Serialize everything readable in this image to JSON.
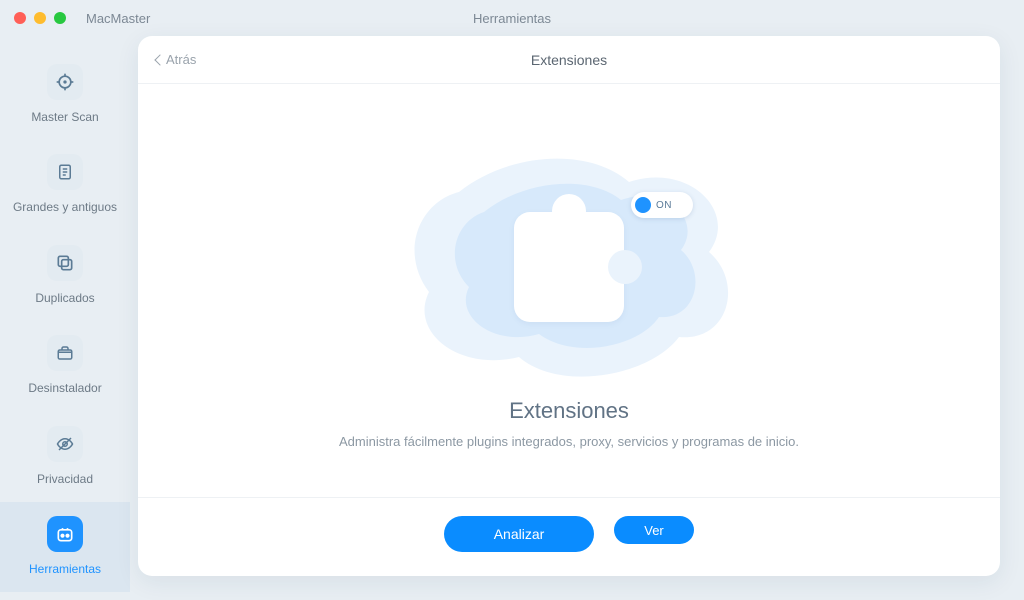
{
  "window": {
    "app_name": "MacMaster",
    "title": "Herramientas"
  },
  "sidebar": {
    "items": [
      {
        "label": "Master Scan",
        "icon": "crosshair-icon"
      },
      {
        "label": "Grandes y antiguos",
        "icon": "document-icon"
      },
      {
        "label": "Duplicados",
        "icon": "copy-icon"
      },
      {
        "label": "Desinstalador",
        "icon": "box-icon"
      },
      {
        "label": "Privacidad",
        "icon": "eye-off-icon"
      },
      {
        "label": "Herramientas",
        "icon": "tools-icon"
      }
    ],
    "active_index": 5
  },
  "card": {
    "back_label": "Atrás",
    "title": "Extensiones",
    "toggle_text": "ON",
    "heading": "Extensiones",
    "subtext": "Administra fácilmente plugins integrados, proxy, servicios y programas de inicio.",
    "analyze_label": "Analizar",
    "view_label": "Ver"
  },
  "colors": {
    "accent": "#0a8cff",
    "illustration": "#e6f2fe"
  }
}
